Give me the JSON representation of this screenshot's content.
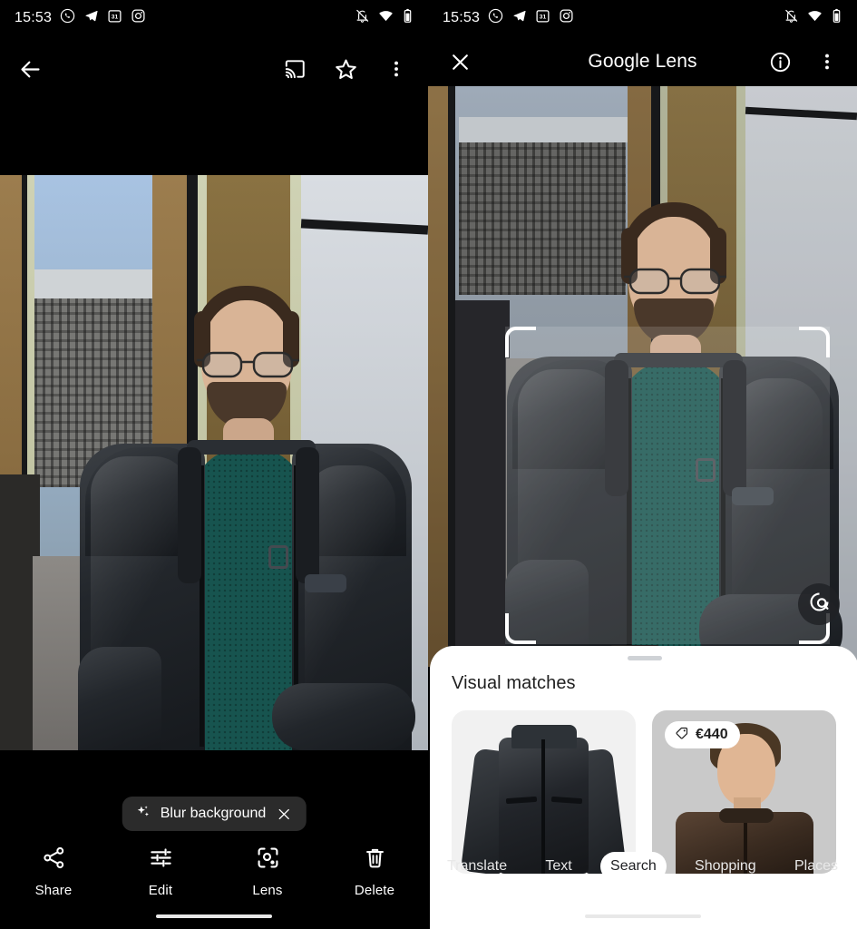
{
  "left_phone": {
    "status_bar": {
      "time": "15:53",
      "left_icons": [
        "whatsapp-icon",
        "telegram-icon",
        "calendar-icon",
        "instagram-icon"
      ],
      "calendar_day": "31",
      "right_icons": [
        "mute-icon",
        "wifi-icon",
        "battery-icon"
      ]
    },
    "app_bar": {
      "back_label": "back-arrow-icon",
      "cast_label": "cast-icon",
      "favorite_label": "star-icon",
      "overflow_label": "more-vert-icon"
    },
    "chip": {
      "label": "Blur background",
      "icon": "sparkle-icon",
      "close": "close-icon"
    },
    "actions": [
      {
        "label": "Share",
        "icon": "share-icon"
      },
      {
        "label": "Edit",
        "icon": "tune-icon"
      },
      {
        "label": "Lens",
        "icon": "lens-icon"
      },
      {
        "label": "Delete",
        "icon": "trash-icon"
      }
    ]
  },
  "right_phone": {
    "status_bar": {
      "time": "15:53",
      "left_icons": [
        "whatsapp-icon",
        "telegram-icon",
        "calendar-icon",
        "instagram-icon"
      ],
      "calendar_day": "31",
      "right_icons": [
        "mute-icon",
        "wifi-icon",
        "battery-icon"
      ]
    },
    "app_bar": {
      "title": "Google Lens",
      "close_label": "close-icon",
      "info_label": "info-icon",
      "overflow_label": "more-vert-icon"
    },
    "viewer": {
      "lens_fab": "lens-refine-icon",
      "selection_frame": "crop-selection"
    },
    "sheet": {
      "title": "Visual matches",
      "cards": [
        {
          "name": "black-leather-jacket",
          "price": ""
        },
        {
          "name": "model-brown-leather-jacket",
          "price": "€440",
          "price_icon": "tag-icon"
        }
      ]
    },
    "modes": [
      {
        "label": "Translate",
        "active": false
      },
      {
        "label": "Text",
        "active": false
      },
      {
        "label": "Search",
        "active": true
      },
      {
        "label": "Shopping",
        "active": false
      },
      {
        "label": "Places",
        "active": false
      }
    ]
  },
  "colors": {
    "background": "#000000",
    "chip_bg": "#2b2b2b",
    "sheet_bg": "#ffffff",
    "active_pill": "#ffffff",
    "accent_text": "#202124"
  }
}
